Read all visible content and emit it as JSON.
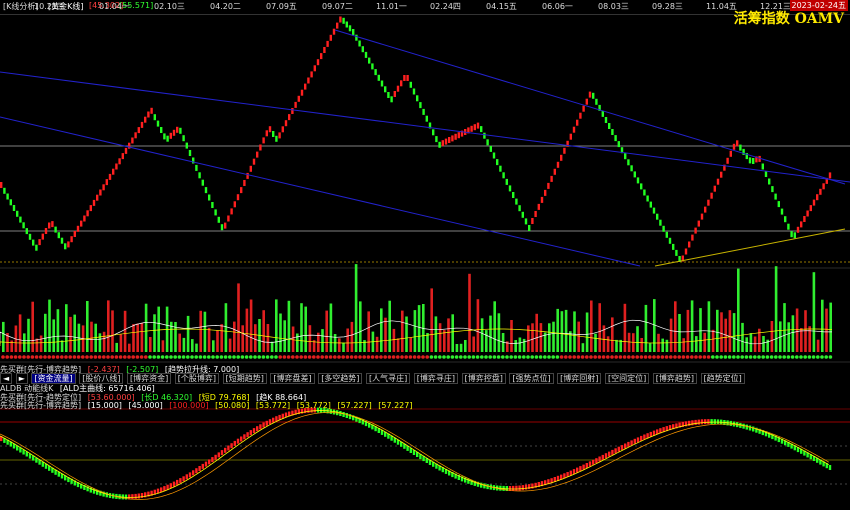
{
  "header": {
    "view_label": "[K线分析]",
    "symbol": "[黄金K线]",
    "value_red": "[45.302]",
    "value_green": "[55.571]",
    "dates": [
      "10.21三",
      "01.04一",
      "02.10三",
      "04.20二",
      "07.09五",
      "09.07二",
      "11.01一",
      "02.24四",
      "04.15五",
      "06.06一",
      "08.03三",
      "09.28三",
      "11.04五",
      "12.21三"
    ],
    "indicator_title": "活筹指数 OAMV",
    "current_date": "2023-02-24五"
  },
  "toolbar": {
    "row1_label": "先买群[先行-博弈趋势]",
    "row1_values": [
      "[-2.437]",
      "[-2.507]",
      "[趋势拉升线: 7.000]"
    ],
    "tabs": [
      "[资金流量]",
      "[股价八线]",
      "[博弈资金]",
      "[个股博弈]",
      "[短期趋势]",
      "[博弈盘差]",
      "[多空趋势]",
      "[人气寻庄]",
      "[博弈寻庄]",
      "[博弈控盘]",
      "[强势点位]",
      "[博弈回射]",
      "[空间定位]",
      "[博弈趋势]",
      "[趋势定位]"
    ],
    "ald_label": "ALDB 动能线K",
    "ald_value": "[ALD主曲线: 65716.406]",
    "row3_label": "先买群[先行-趋势定位]",
    "row3_values": [
      "[53.60.000]",
      "[长D 46.320]",
      "[短D 79.768]",
      "[趋K 88.664]"
    ],
    "row4_label": "先买群[先行-博弈趋势]",
    "row4_values": [
      "[15.000]",
      "[45.000]",
      "[100.000]",
      "[50.080]",
      "[53.772]",
      "[53.772]",
      "[57.227]",
      "[57.227]"
    ]
  },
  "chart_data": {
    "type": "bar",
    "title": "活筹指数 OAMV",
    "xlabel": "",
    "ylabel": "",
    "categories": [
      "10.21三",
      "01.04一",
      "02.10三",
      "04.20二",
      "07.09五",
      "09.07二",
      "11.01一",
      "02.24四",
      "04.15五",
      "06.06一",
      "08.03三",
      "09.28三",
      "11.04五",
      "12.21三"
    ]
  },
  "colors": {
    "up": "#ff2020",
    "down": "#22ff22",
    "channel": "#2222cc",
    "support": "#c8b400",
    "ma1": "#ffffff",
    "ma2": "#ffff00"
  }
}
